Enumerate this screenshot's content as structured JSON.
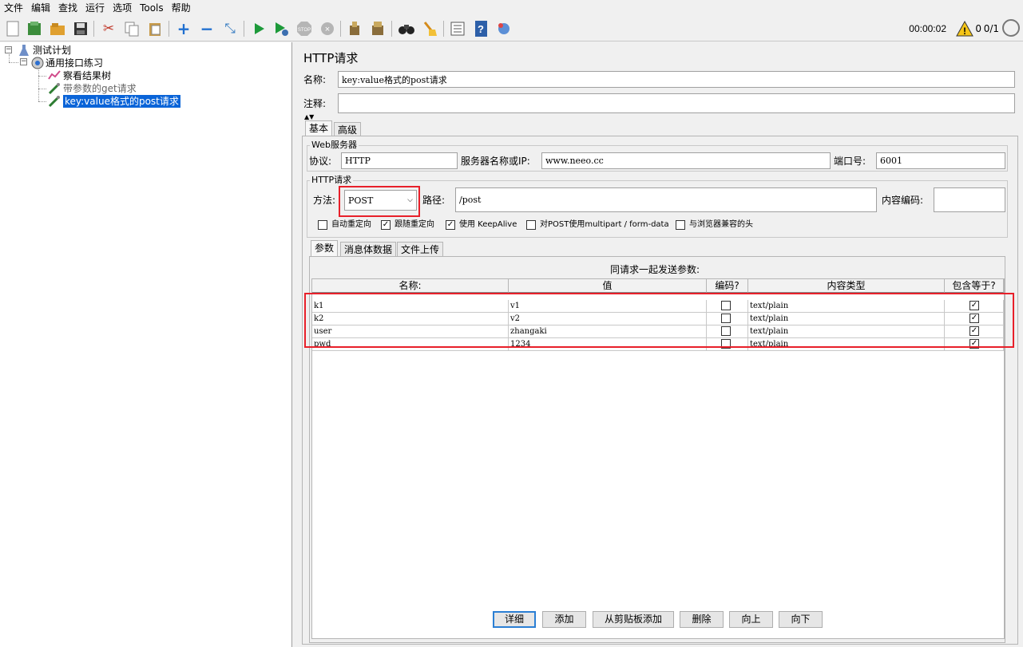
{
  "menu": [
    "文件",
    "编辑",
    "查找",
    "运行",
    "选项",
    "Tools",
    "帮助"
  ],
  "toolbar": {
    "icons": [
      "new-icon",
      "templates-icon",
      "open-icon",
      "save-icon",
      "cut-icon",
      "copy-icon",
      "paste-icon",
      "expand-icon",
      "collapse-icon",
      "toggle-icon",
      "start-icon",
      "start-no-pause-icon",
      "stop-icon",
      "shutdown-icon",
      "clear-icon",
      "clear-all-icon",
      "search-icon",
      "reset-search-icon",
      "function-helper-icon",
      "help-icon",
      "remote-icon"
    ],
    "timer": "00:00:02",
    "error_count": "0",
    "threads": "0/1"
  },
  "tree": {
    "root": "测试计划",
    "thread_group": "通用接口练习",
    "children": [
      {
        "label": "察看结果树",
        "icon": "view-results-tree-icon"
      },
      {
        "label": "带参数的get请求",
        "icon": "http-sampler-icon",
        "disabled": true
      },
      {
        "label": "key:value格式的post请求",
        "icon": "http-sampler-icon",
        "selected": true
      }
    ]
  },
  "panel": {
    "title": "HTTP请求",
    "name_label": "名称:",
    "name_value": "key:value格式的post请求",
    "comment_label": "注释:",
    "comment_value": "",
    "tabs": [
      "基本",
      "高级"
    ],
    "web_server": {
      "group_title": "Web服务器",
      "protocol_label": "协议:",
      "protocol_value": "HTTP",
      "server_label": "服务器名称或IP:",
      "server_value": "www.neeo.cc",
      "port_label": "端口号:",
      "port_value": "6001"
    },
    "http_request": {
      "group_title": "HTTP请求",
      "method_label": "方法:",
      "method_value": "POST",
      "path_label": "路径:",
      "path_value": "/post",
      "encoding_label": "内容编码:",
      "encoding_value": ""
    },
    "options": [
      {
        "label": "自动重定向",
        "checked": false
      },
      {
        "label": "跟随重定向",
        "checked": true
      },
      {
        "label": "使用 KeepAlive",
        "checked": true
      },
      {
        "label": "对POST使用multipart / form-data",
        "checked": false
      },
      {
        "label": "与浏览器兼容的头",
        "checked": false
      }
    ],
    "param_tabs": [
      "参数",
      "消息体数据",
      "文件上传"
    ],
    "params_caption": "同请求一起发送参数:",
    "columns": [
      "名称:",
      "值",
      "编码?",
      "内容类型",
      "包含等于?"
    ],
    "rows": [
      {
        "name": "k1",
        "value": "v1",
        "encode": false,
        "content_type": "text/plain",
        "include_equals": true
      },
      {
        "name": "k2",
        "value": "v2",
        "encode": false,
        "content_type": "text/plain",
        "include_equals": true
      },
      {
        "name": "user",
        "value": "zhangaki",
        "encode": false,
        "content_type": "text/plain",
        "include_equals": true
      },
      {
        "name": "pwd",
        "value": "1234",
        "encode": false,
        "content_type": "text/plain",
        "include_equals": true
      }
    ],
    "buttons": [
      "详细",
      "添加",
      "从剪贴板添加",
      "删除",
      "向上",
      "向下"
    ]
  },
  "colors": {
    "selection": "#0a64d8",
    "highlight_box": "#e8202a",
    "primary_button_border": "#2b7fd4"
  }
}
